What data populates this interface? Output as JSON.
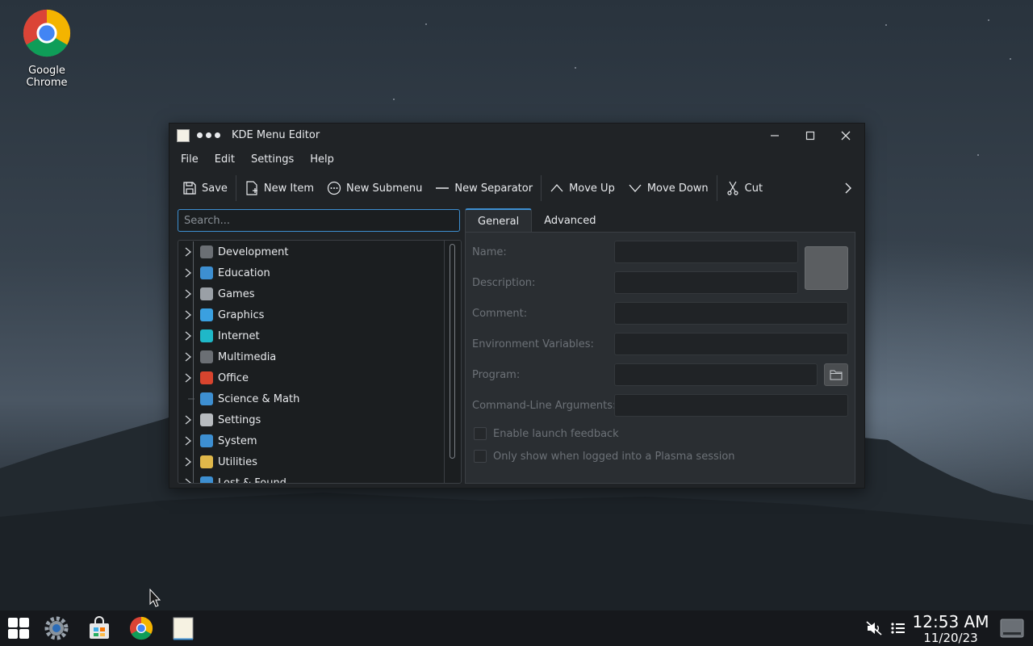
{
  "desktop": {
    "icon_label": "Google Chrome"
  },
  "window": {
    "title": "KDE Menu Editor",
    "controls": {
      "minimize": "–",
      "maximize": "☐",
      "close": "✕"
    }
  },
  "menubar": [
    "File",
    "Edit",
    "Settings",
    "Help"
  ],
  "toolbar": {
    "save": "Save",
    "new_item": "New Item",
    "new_submenu": "New Submenu",
    "new_separator": "New Separator",
    "move_up": "Move Up",
    "move_down": "Move Down",
    "cut": "Cut"
  },
  "search": {
    "placeholder": "Search..."
  },
  "categories": [
    {
      "label": "Development",
      "color": "#6b6f74"
    },
    {
      "label": "Education",
      "color": "#3d8fd1"
    },
    {
      "label": "Games",
      "color": "#9aa0a6"
    },
    {
      "label": "Graphics",
      "color": "#3aa0e0"
    },
    {
      "label": "Internet",
      "color": "#1fb8c8"
    },
    {
      "label": "Multimedia",
      "color": "#6b6f74"
    },
    {
      "label": "Office",
      "color": "#d8442e"
    },
    {
      "label": "Science & Math",
      "color": "#3d8fd1"
    },
    {
      "label": "Settings",
      "color": "#b8bcc0"
    },
    {
      "label": "System",
      "color": "#3d8fd1"
    },
    {
      "label": "Utilities",
      "color": "#e0b84a"
    },
    {
      "label": "Lost & Found",
      "color": "#3d8fd1"
    }
  ],
  "tabs": {
    "general": "General",
    "advanced": "Advanced"
  },
  "form": {
    "name": "Name:",
    "description": "Description:",
    "comment": "Comment:",
    "env": "Environment Variables:",
    "program": "Program:",
    "args": "Command-Line Arguments:",
    "launch_feedback": "Enable launch feedback",
    "plasma_only": "Only show when logged into a Plasma session"
  },
  "clock": {
    "time": "12:53 AM",
    "date": "11/20/23"
  },
  "colors": {
    "accent": "#3d8fd1",
    "window_bg": "#202326",
    "panel_bg": "#2a2e32"
  }
}
